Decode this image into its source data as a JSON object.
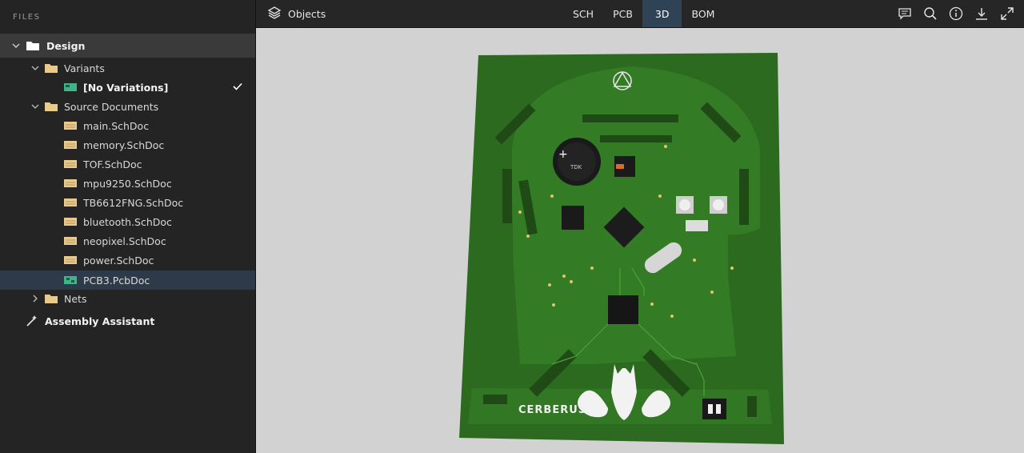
{
  "sidebar": {
    "header": "FILES",
    "root": {
      "label": "Design"
    },
    "variants": {
      "label": "Variants",
      "child": "[No Variations]"
    },
    "source_documents": {
      "label": "Source Documents",
      "items": [
        "main.SchDoc",
        "memory.SchDoc",
        "TOF.SchDoc",
        "mpu9250.SchDoc",
        "TB6612FNG.SchDoc",
        "bluetooth.SchDoc",
        "neopixel.SchDoc",
        "power.SchDoc",
        "PCB3.PcbDoc"
      ]
    },
    "nets": {
      "label": "Nets"
    },
    "assembly": {
      "label": "Assembly Assistant"
    }
  },
  "toolbar": {
    "objects_label": "Objects",
    "tabs": [
      "SCH",
      "PCB",
      "3D",
      "BOM"
    ],
    "active_tab": "3D",
    "tools": [
      "comment-icon",
      "search-icon",
      "info-icon",
      "download-icon",
      "fullscreen-icon"
    ]
  },
  "board": {
    "silkscreen_name": "CERBERUS",
    "buzzer_label": "TDK",
    "colors": {
      "pcb": "#2f6e22",
      "accent": "#2f4357",
      "viewport_bg": "#d2d2d2"
    }
  }
}
